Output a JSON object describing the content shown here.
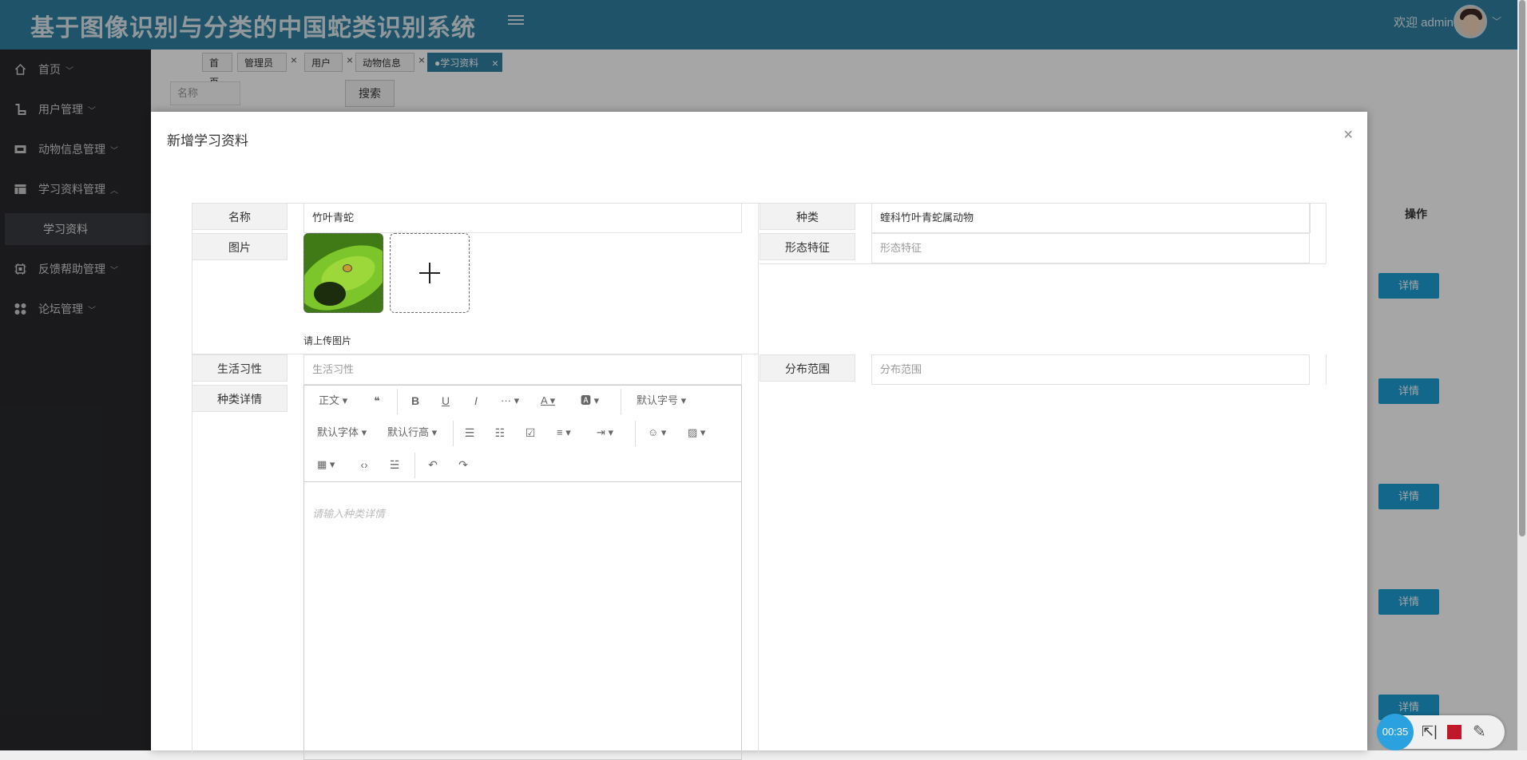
{
  "header": {
    "app_title": "基于图像识别与分类的中国蛇类识别系统",
    "welcome": "欢迎 admin",
    "avatar_caret": "﹀"
  },
  "sidebar": {
    "items": [
      {
        "label": "首页",
        "icon": "home-icon"
      },
      {
        "label": "用户管理",
        "icon": "user-manage-icon"
      },
      {
        "label": "动物信息管理",
        "icon": "animal-info-icon"
      },
      {
        "label": "学习资料管理",
        "icon": "study-material-icon"
      },
      {
        "label": "反馈帮助管理",
        "icon": "feedback-icon"
      },
      {
        "label": "论坛管理",
        "icon": "forum-icon"
      }
    ],
    "sub_item": "学习资料"
  },
  "tabs": [
    {
      "label": "首页"
    },
    {
      "label": "管理员"
    },
    {
      "label": "用户"
    },
    {
      "label": "动物信息"
    },
    {
      "label": "●学习资料"
    }
  ],
  "search": {
    "placeholder": "名称",
    "button": "搜索"
  },
  "table": {
    "op_header": "操作",
    "detail_label": "详情"
  },
  "modal": {
    "title": "新增学习资料",
    "close": "×",
    "fields": {
      "name_label": "名称",
      "name_value": "竹叶青蛇",
      "category_label": "种类",
      "category_value": "蝰科竹叶青蛇属动物",
      "image_label": "图片",
      "image_hint": "请上传图片",
      "morph_label": "形态特征",
      "morph_placeholder": "形态特征",
      "habit_label": "生活习性",
      "habit_placeholder": "生活习性",
      "dist_label": "分布范围",
      "dist_placeholder": "分布范围",
      "detail_label": "种类详情",
      "detail_placeholder": "请输入种类详情"
    },
    "editor_toolbar": {
      "paragraph": "正文",
      "font_size": "默认字号",
      "font_family": "默认字体",
      "line_height": "默认行高"
    }
  },
  "recorder": {
    "time": "00:35"
  },
  "colors": {
    "header": "#2f80a3",
    "sidebar": "#28292c",
    "detail_button": "#1e9fd6",
    "recorder_stop": "#c0192a"
  }
}
